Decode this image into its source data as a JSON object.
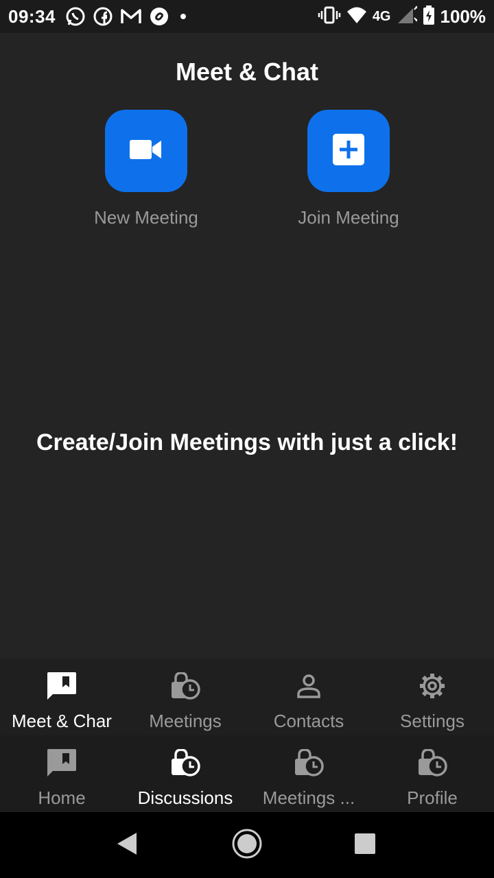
{
  "status_bar": {
    "time": "09:34",
    "network": "4G",
    "battery": "100%",
    "left_icons": [
      "whatsapp-icon",
      "facebook-icon",
      "gmail-icon",
      "sync-app-icon",
      "notification-dot-icon"
    ],
    "right_icons": [
      "vibrate-icon",
      "wifi-icon",
      "signal-icon",
      "battery-charging-icon"
    ]
  },
  "header": {
    "title": "Meet & Chat"
  },
  "actions": {
    "new_meeting": {
      "label": "New Meeting",
      "icon": "video-camera-icon"
    },
    "join_meeting": {
      "label": "Join Meeting",
      "icon": "plus-square-icon"
    }
  },
  "main": {
    "tagline": "Create/Join Meetings with just a click!"
  },
  "nav_top": [
    {
      "label": "Meet & Char",
      "icon": "chat-bookmark-icon",
      "active": true
    },
    {
      "label": "Meetings",
      "icon": "lock-clock-icon",
      "active": false
    },
    {
      "label": "Contacts",
      "icon": "person-icon",
      "active": false
    },
    {
      "label": "Settings",
      "icon": "gear-icon",
      "active": false
    }
  ],
  "nav_bottom": [
    {
      "label": "Home",
      "icon": "chat-bookmark-icon",
      "active": false
    },
    {
      "label": "Discussions",
      "icon": "lock-clock-icon",
      "active": true
    },
    {
      "label": "Meetings ...",
      "icon": "lock-clock-icon",
      "active": false
    },
    {
      "label": "Profile",
      "icon": "lock-clock-icon",
      "active": false
    }
  ],
  "colors": {
    "background": "#242424",
    "accent": "#0e71eb",
    "inactive_text": "#9a9a9a"
  }
}
